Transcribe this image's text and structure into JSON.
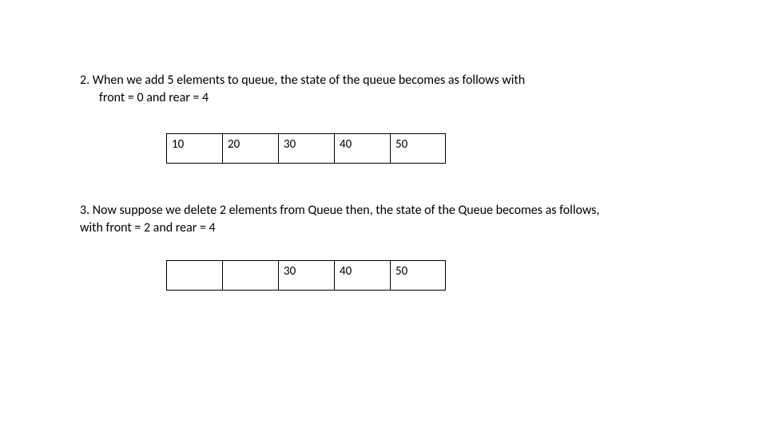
{
  "items": [
    {
      "number": "2.",
      "text_line1": "When we add 5 elements to queue, the state of the queue becomes as follows with",
      "text_line2": "front = 0 and rear = 4",
      "cells": [
        "10",
        "20",
        "30",
        "40",
        "50"
      ]
    },
    {
      "number": "3.",
      "text_line1": "Now suppose we delete 2 elements from Queue then, the state of the Queue becomes as follows,",
      "text_line2": "with front = 2 and rear = 4",
      "cells": [
        "",
        "",
        "30",
        "40",
        "50"
      ]
    }
  ]
}
